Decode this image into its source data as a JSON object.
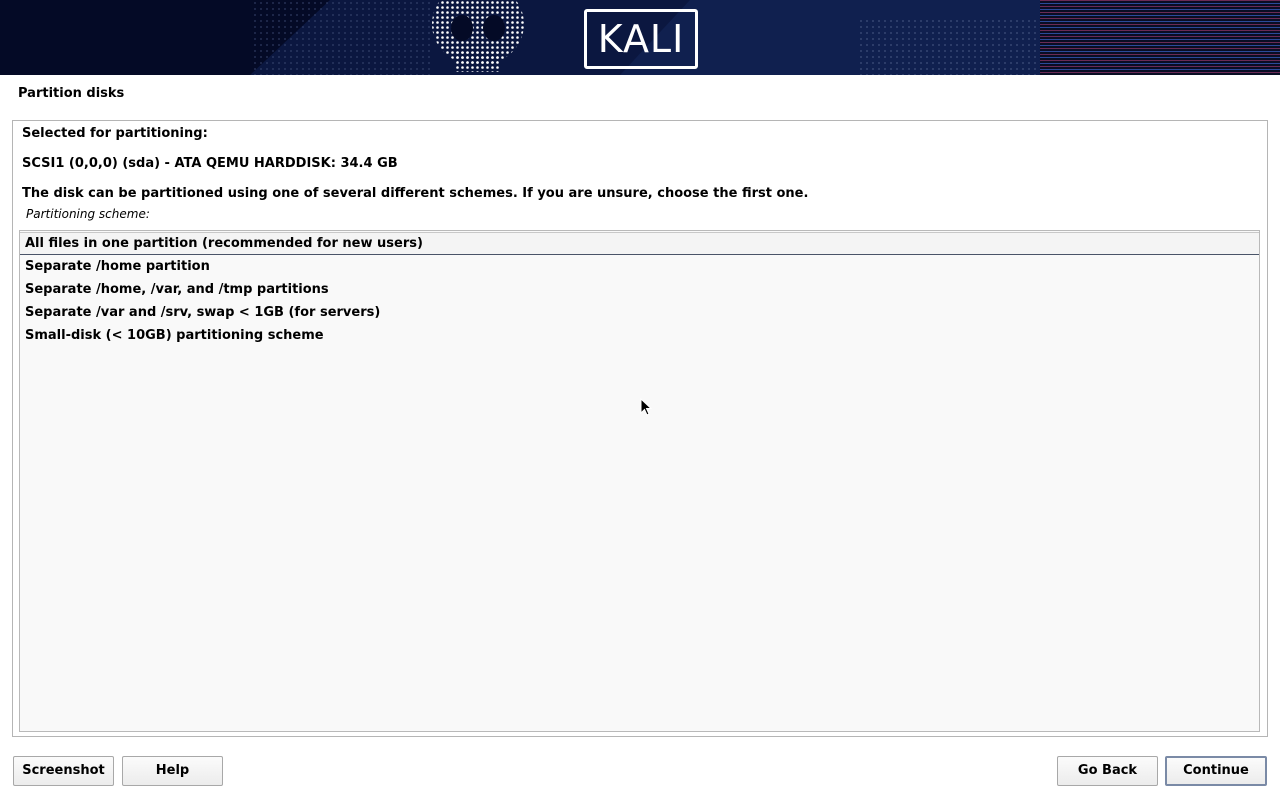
{
  "banner": {
    "logo_text": "KALI",
    "background_color": "#040a26"
  },
  "page_title": "Partition disks",
  "panel": {
    "selected_heading": "Selected for partitioning:",
    "disk": "SCSI1 (0,0,0) (sda) - ATA QEMU HARDDISK: 34.4 GB",
    "description": "The disk can be partitioned using one of several different schemes. If you are unsure, choose the first one.",
    "scheme_label": "Partitioning scheme:",
    "options": [
      {
        "label": "All files in one partition (recommended for new users)",
        "selected": true
      },
      {
        "label": "Separate /home partition",
        "selected": false
      },
      {
        "label": "Separate /home, /var, and /tmp partitions",
        "selected": false
      },
      {
        "label": "Separate /var and /srv, swap < 1GB (for servers)",
        "selected": false
      },
      {
        "label": "Small-disk (< 10GB) partitioning scheme",
        "selected": false
      }
    ]
  },
  "buttons": {
    "screenshot": "Screenshot",
    "help": "Help",
    "go_back": "Go Back",
    "continue": "Continue"
  }
}
